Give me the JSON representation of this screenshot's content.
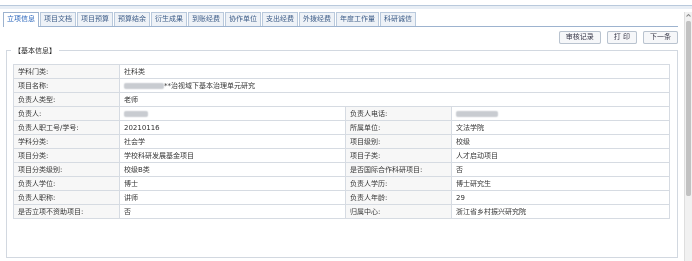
{
  "tabs": [
    "立项信息",
    "项目文档",
    "项目预算",
    "预算结余",
    "衍生成果",
    "到账经费",
    "协作单位",
    "支出经费",
    "外拨经费",
    "年度工作量",
    "科研诚信"
  ],
  "toolbar": {
    "review": "审核记录",
    "print": "打 印",
    "next": "下一条"
  },
  "section_title": "【基本信息】",
  "rows": [
    {
      "l1": "学科门类:",
      "v1": "社科类"
    },
    {
      "l1": "项目名称:",
      "v1": "**治视域下基本治理单元研究"
    },
    {
      "l1": "负责人类型:",
      "v1": "老师"
    },
    {
      "l1": "负责人:",
      "v1": "",
      "l2": "负责人电话:",
      "v2": ""
    },
    {
      "l1": "负责人职工号/学号:",
      "v1": "20210116",
      "l2": "所属单位:",
      "v2": "文法学院"
    },
    {
      "l1": "学科分类:",
      "v1": "社会学",
      "l2": "项目级别:",
      "v2": "校级"
    },
    {
      "l1": "项目分类:",
      "v1": "学校科研发展基金项目",
      "l2": "项目子类:",
      "v2": "人才启动项目"
    },
    {
      "l1": "项目分类级别:",
      "v1": "校级B类",
      "l2": "是否国际合作科研项目:",
      "v2": "否"
    },
    {
      "l1": "负责人学位:",
      "v1": "博士",
      "l2": "负责人学历:",
      "v2": "博士研究生"
    },
    {
      "l1": "负责人职称:",
      "v1": "讲师",
      "l2": "负责人年龄:",
      "v2": "29"
    },
    {
      "l1": "是否立项不资助项目:",
      "v1": "否",
      "l2": "归属中心:",
      "v2": "浙江省乡村振兴研究院"
    }
  ]
}
